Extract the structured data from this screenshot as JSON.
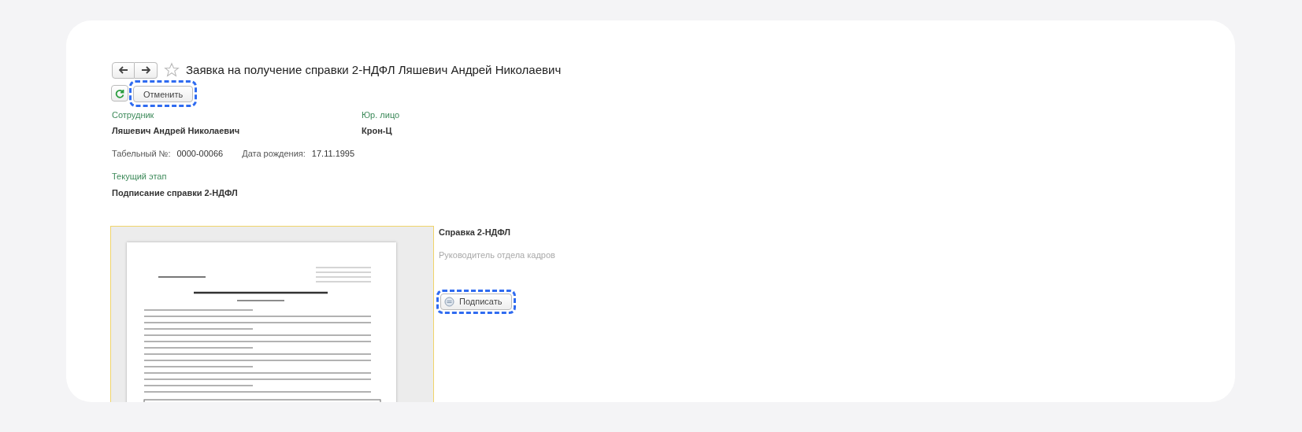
{
  "window": {
    "title": "Заявка на получение справки 2-НДФЛ Ляшевич Андрей Николаевич",
    "favorite": false
  },
  "toolbar": {
    "cancel_button": {
      "label": "Отменить",
      "highlighted": true
    }
  },
  "employee": {
    "label": "Сотрудник",
    "value": "Ляшевич Андрей Николаевич"
  },
  "legal_entity": {
    "label": "Юр. лицо",
    "value": "Крон-Ц"
  },
  "details": [
    {
      "label": "Табельный №:",
      "value": "0000-00066"
    },
    {
      "label": "Дата рождения:",
      "value": "17.11.1995"
    }
  ],
  "stage": {
    "label": "Текущий этап",
    "value": "Подписание справки 2-НДФЛ"
  },
  "signing": {
    "title": "Справка 2-НДФЛ",
    "signer": "Руководитель отдела кадров",
    "button": {
      "label": "Подписать",
      "highlighted": true
    }
  }
}
